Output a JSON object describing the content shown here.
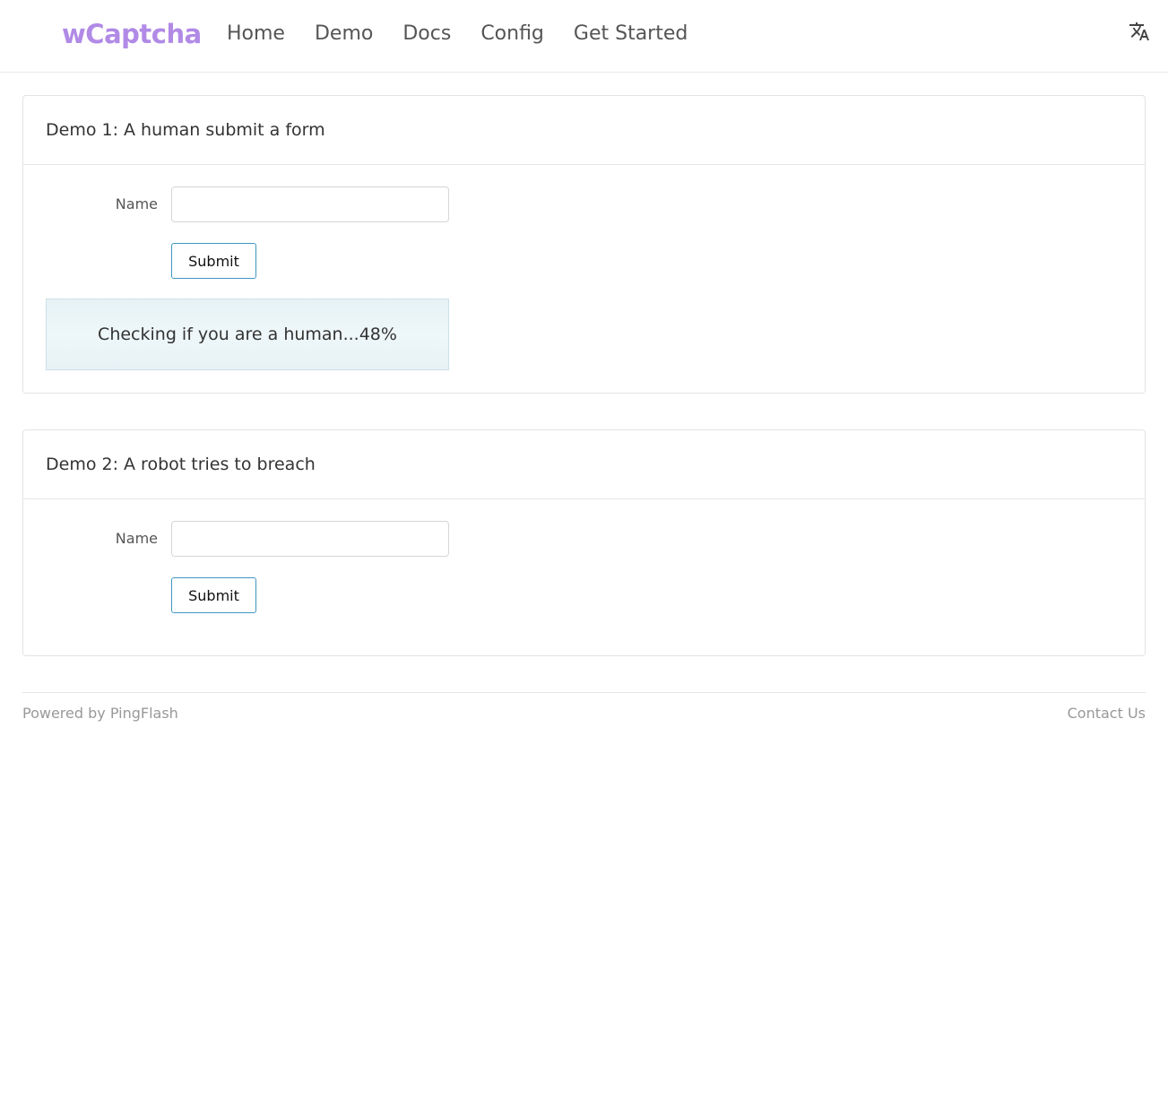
{
  "header": {
    "logo": "wCaptcha",
    "nav": [
      "Home",
      "Demo",
      "Docs",
      "Config",
      "Get Started"
    ],
    "lang_icon": "translate-icon"
  },
  "demos": [
    {
      "title": "Demo 1: A human submit a form",
      "name_label": "Name",
      "name_value": "",
      "submit_label": "Submit",
      "status": "Checking if you are a human...48%",
      "progress_percent": 48
    },
    {
      "title": "Demo 2: A robot tries to breach",
      "name_label": "Name",
      "name_value": "",
      "submit_label": "Submit"
    }
  ],
  "footer": {
    "left": "Powered by PingFlash",
    "right": "Contact Us"
  },
  "colors": {
    "brand": "#b18ae6",
    "button_border": "#3f97c4",
    "captcha_bg": "#e9f4f7",
    "muted_text": "#999999"
  }
}
